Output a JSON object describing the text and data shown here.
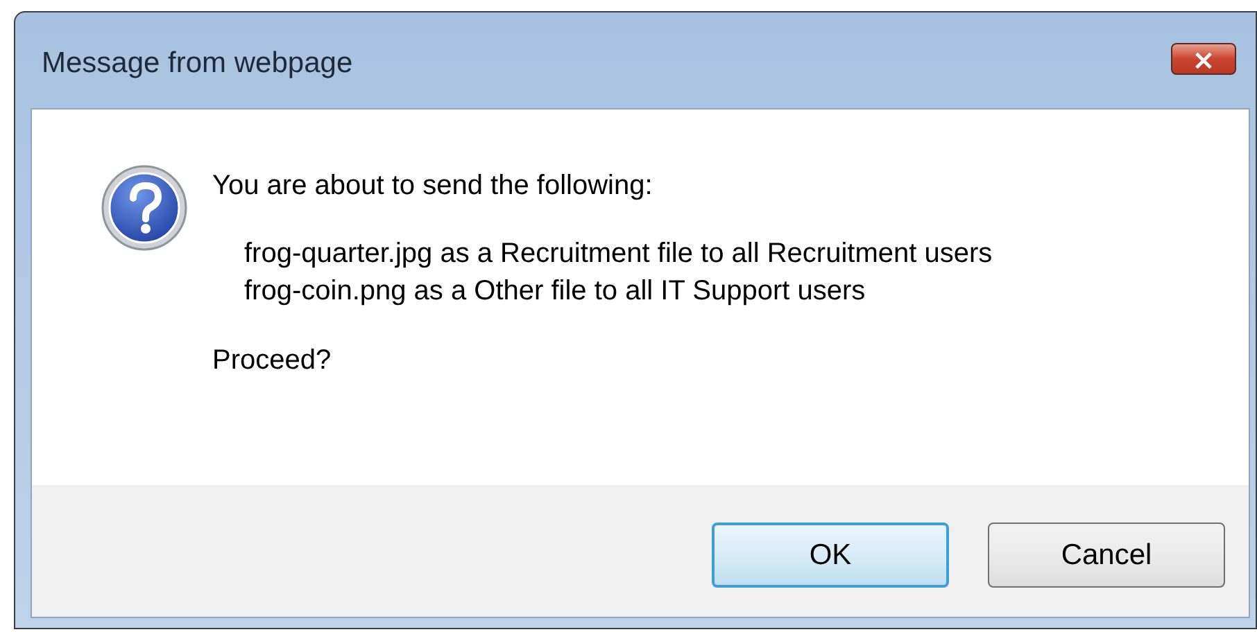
{
  "window": {
    "title": "Message from webpage",
    "close": "×"
  },
  "message": {
    "intro": "You are about to send the following:",
    "lines": [
      "frog-quarter.jpg as a Recruitment file to all Recruitment users",
      "frog-coin.png as a Other file to all IT Support users"
    ],
    "question": "Proceed?"
  },
  "buttons": [
    {
      "label": "OK",
      "focused": true
    },
    {
      "label": "Cancel",
      "focused": false
    }
  ]
}
